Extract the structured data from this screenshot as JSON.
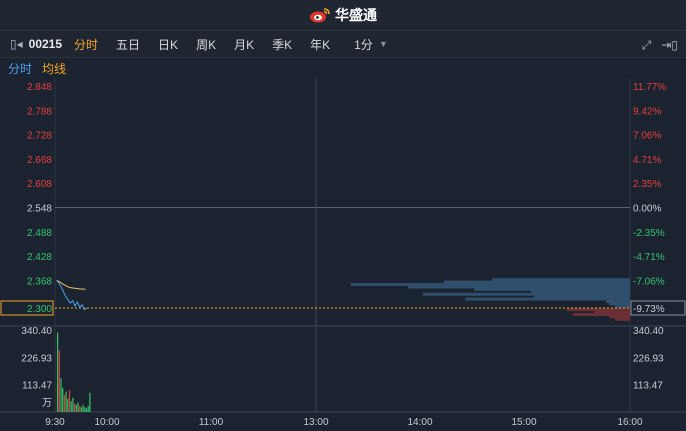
{
  "header": {
    "brand": "华盛通"
  },
  "toolbar": {
    "code": "00215",
    "periods": [
      "分时",
      "五日",
      "日K",
      "周K",
      "月K",
      "季K",
      "年K"
    ],
    "interval": "1分"
  },
  "subtabs": {
    "fenshi": "分时",
    "junxian": "均线"
  },
  "chart_data": {
    "type": "line",
    "price_axis_labels": [
      "2.848",
      "2.788",
      "2.728",
      "2.668",
      "2.608",
      "2.548",
      "2.488",
      "2.428",
      "2.368",
      "2.300"
    ],
    "percent_axis_labels": [
      "11.77%",
      "9.42%",
      "7.06%",
      "4.71%",
      "2.35%",
      "0.00%",
      "-2.35%",
      "-4.71%",
      "-7.06%",
      "-9.73%"
    ],
    "price_ticks": [
      2.848,
      2.788,
      2.728,
      2.668,
      2.608,
      2.548,
      2.488,
      2.428,
      2.368,
      2.3
    ],
    "prev_close": 2.548,
    "current_price": "2.300",
    "current_percent": "-9.73%",
    "volume_axis_labels": [
      "340.40",
      "226.93",
      "113.47",
      "万"
    ],
    "volume_axis_labels_right": [
      "340.40",
      "226.93",
      "113.47"
    ],
    "volume_ticks": [
      340.4,
      226.93,
      113.47,
      0
    ],
    "time_labels": [
      "9:30",
      "10:00",
      "11:00",
      "13:00",
      "14:00",
      "15:00",
      "16:00"
    ],
    "price_series": [
      {
        "t": 0,
        "p": 2.368
      },
      {
        "t": 1,
        "p": 2.362
      },
      {
        "t": 2,
        "p": 2.352
      },
      {
        "t": 3,
        "p": 2.34
      },
      {
        "t": 4,
        "p": 2.328
      },
      {
        "t": 5,
        "p": 2.32
      },
      {
        "t": 6,
        "p": 2.312
      },
      {
        "t": 7,
        "p": 2.318
      },
      {
        "t": 8,
        "p": 2.305
      },
      {
        "t": 9,
        "p": 2.315
      },
      {
        "t": 10,
        "p": 2.302
      },
      {
        "t": 11,
        "p": 2.308
      },
      {
        "t": 12,
        "p": 2.296
      },
      {
        "t": 13,
        "p": 2.3
      }
    ],
    "avg_series": [
      {
        "t": 0,
        "p": 2.368
      },
      {
        "t": 2,
        "p": 2.365
      },
      {
        "t": 4,
        "p": 2.36
      },
      {
        "t": 6,
        "p": 2.356
      },
      {
        "t": 8,
        "p": 2.352
      },
      {
        "t": 10,
        "p": 2.35
      },
      {
        "t": 12,
        "p": 2.349
      },
      {
        "t": 14,
        "p": 2.348
      },
      {
        "t": 16,
        "p": 2.347
      },
      {
        "t": 18,
        "p": 2.347
      },
      {
        "t": 20,
        "p": 2.346
      }
    ],
    "volume_series": [
      {
        "t": 0,
        "v": 330,
        "up": false
      },
      {
        "t": 1,
        "v": 255,
        "up": true
      },
      {
        "t": 2,
        "v": 140,
        "up": false
      },
      {
        "t": 3,
        "v": 100,
        "up": false
      },
      {
        "t": 4,
        "v": 70,
        "up": true
      },
      {
        "t": 5,
        "v": 85,
        "up": false
      },
      {
        "t": 6,
        "v": 55,
        "up": false
      },
      {
        "t": 7,
        "v": 90,
        "up": true
      },
      {
        "t": 8,
        "v": 45,
        "up": false
      },
      {
        "t": 9,
        "v": 60,
        "up": false
      },
      {
        "t": 10,
        "v": 35,
        "up": true
      },
      {
        "t": 11,
        "v": 30,
        "up": false
      },
      {
        "t": 12,
        "v": 40,
        "up": false
      },
      {
        "t": 13,
        "v": 25,
        "up": true
      },
      {
        "t": 14,
        "v": 20,
        "up": false
      },
      {
        "t": 15,
        "v": 30,
        "up": false
      },
      {
        "t": 16,
        "v": 20,
        "up": false
      },
      {
        "t": 17,
        "v": 15,
        "up": false
      },
      {
        "t": 18,
        "v": 25,
        "up": false
      },
      {
        "t": 19,
        "v": 80,
        "up": false
      }
    ],
    "depth_sell": [
      {
        "p": 2.37,
        "v": 0.46
      },
      {
        "p": 2.364,
        "v": 0.62
      },
      {
        "p": 2.358,
        "v": 0.93
      },
      {
        "p": 2.352,
        "v": 0.74
      },
      {
        "p": 2.346,
        "v": 0.52
      },
      {
        "p": 2.34,
        "v": 0.33
      },
      {
        "p": 2.334,
        "v": 0.69
      },
      {
        "p": 2.328,
        "v": 0.32
      },
      {
        "p": 2.322,
        "v": 0.55
      },
      {
        "p": 2.316,
        "v": 0.08
      },
      {
        "p": 2.31,
        "v": 0.07
      },
      {
        "p": 2.304,
        "v": 0.05
      }
    ],
    "depth_buy": [
      {
        "p": 2.296,
        "v": 0.21
      },
      {
        "p": 2.29,
        "v": 0.12
      },
      {
        "p": 2.284,
        "v": 0.19
      },
      {
        "p": 2.278,
        "v": 0.07
      },
      {
        "p": 2.272,
        "v": 0.05
      }
    ],
    "colors": {
      "up": "#e0403a",
      "down": "#35c46a",
      "flat": "#c8ccd2",
      "price_line": "#4aa3f0",
      "avg_line": "#f0c060",
      "sell_depth": "#2f4f6c",
      "buy_depth": "#6b2f36",
      "grid": "#2c3543",
      "current_line": "#f5a623"
    }
  }
}
